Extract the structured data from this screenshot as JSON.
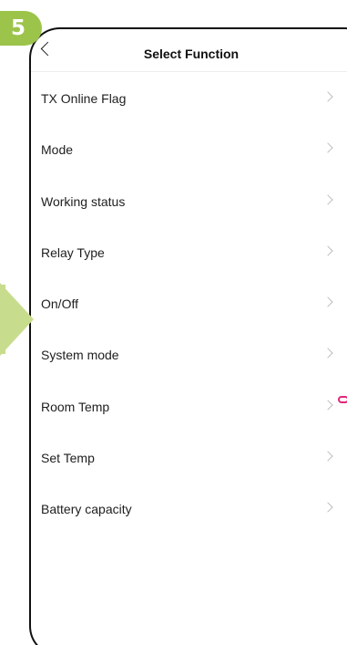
{
  "step": {
    "number": "5"
  },
  "header": {
    "title": "Select Function"
  },
  "functions": [
    {
      "label": "TX Online Flag"
    },
    {
      "label": "Mode"
    },
    {
      "label": "Working status"
    },
    {
      "label": "Relay Type"
    },
    {
      "label": "On/Off"
    },
    {
      "label": "System mode"
    },
    {
      "label": "Room Temp"
    },
    {
      "label": "Set Temp"
    },
    {
      "label": "Battery capacity"
    }
  ],
  "colors": {
    "badge": "#9cc44a",
    "arrow": "#c8dc8e",
    "pointer": "#e0267a"
  }
}
